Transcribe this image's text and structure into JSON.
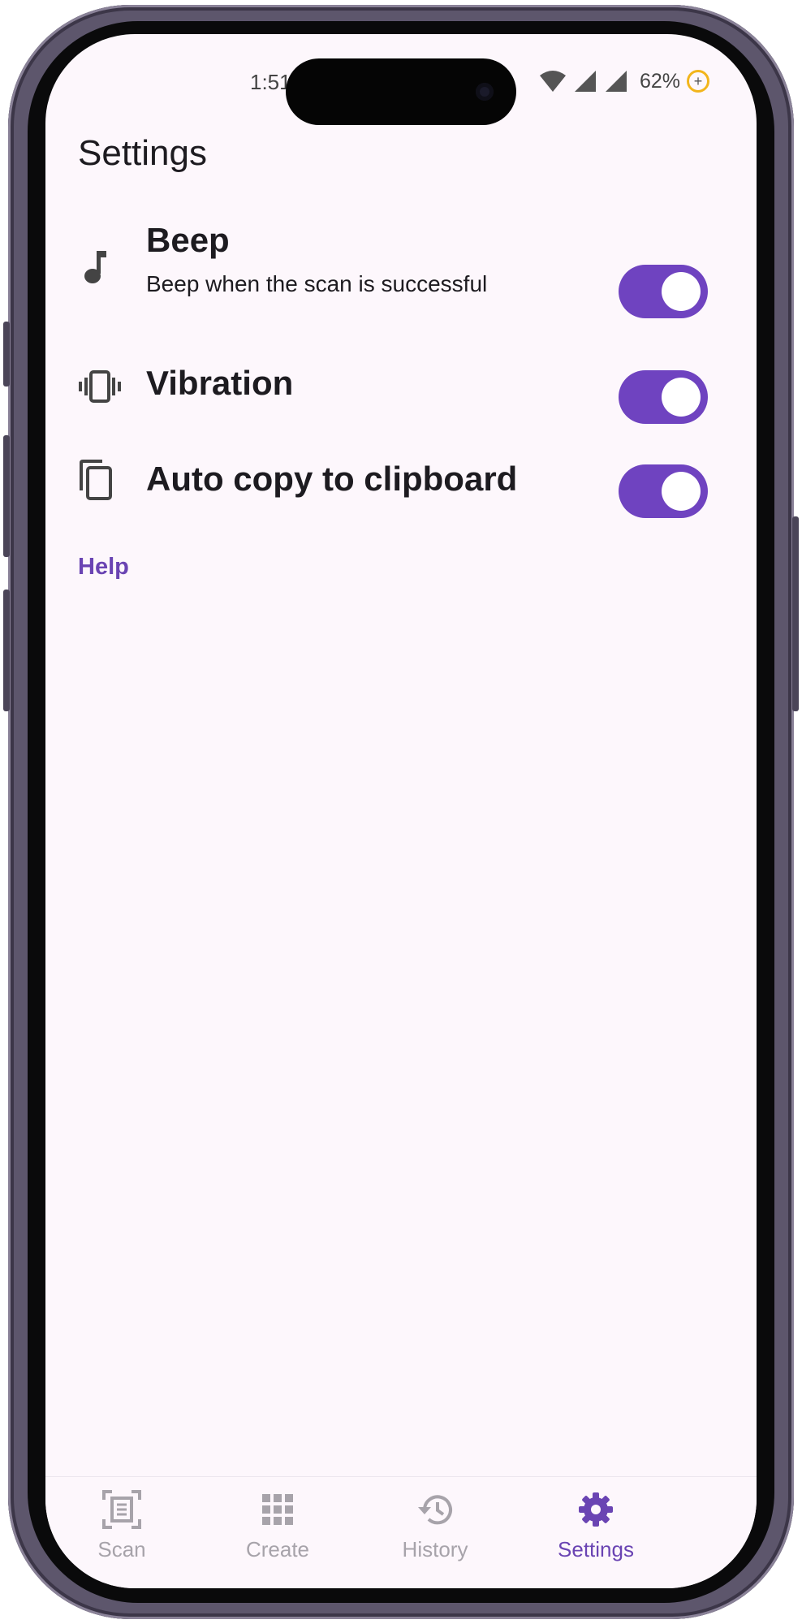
{
  "status_bar": {
    "time": "1:51",
    "battery_percent": "62%"
  },
  "page": {
    "title": "Settings"
  },
  "settings": [
    {
      "icon": "music-note-icon",
      "title": "Beep",
      "subtitle": "Beep when the scan is successful",
      "enabled": true
    },
    {
      "icon": "vibration-icon",
      "title": "Vibration",
      "enabled": true
    },
    {
      "icon": "copy-icon",
      "title": "Auto copy to clipboard",
      "enabled": true
    }
  ],
  "help_label": "Help",
  "bottom_nav": {
    "items": [
      {
        "icon": "scan-document-icon",
        "label": "Scan"
      },
      {
        "icon": "grid-icon",
        "label": "Create"
      },
      {
        "icon": "history-icon",
        "label": "History"
      },
      {
        "icon": "gear-icon",
        "label": "Settings"
      }
    ],
    "active": "Settings"
  },
  "colors": {
    "accent": "#6f43c0",
    "accent_text": "#6a44b3",
    "background": "#fdf7fc",
    "inactive_nav": "#a7a3aa"
  }
}
